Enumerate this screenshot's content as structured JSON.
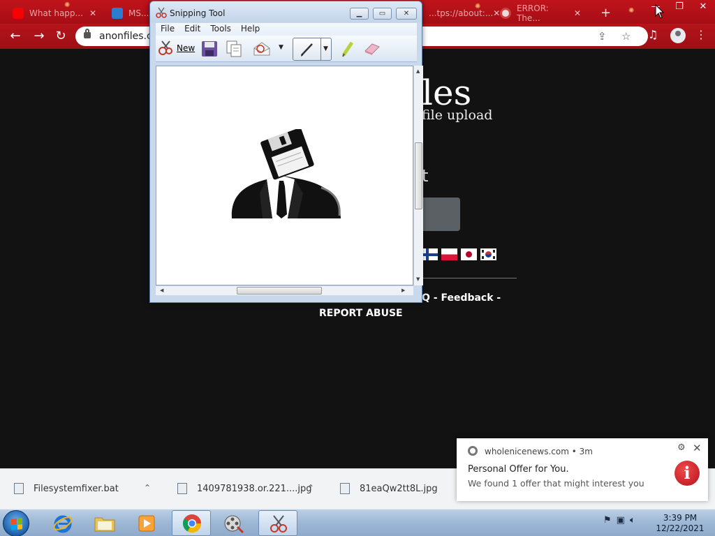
{
  "browser": {
    "tabs": [
      {
        "title": "What happ..."
      },
      {
        "title": "MS..."
      },
      {
        "title": "...tps://about:..."
      },
      {
        "title": "ERROR: The..."
      }
    ],
    "new_tab_label": "+",
    "url": "anonfiles.com",
    "window_controls": {
      "minimize": "—",
      "restore": "❐",
      "close": "✕"
    }
  },
  "page": {
    "logo_tail": "les",
    "tagline_tail": "file upload",
    "heading_tail": "t",
    "footer_tail": "Q - Feedback -",
    "report_abuse": "REPORT ABUSE"
  },
  "snipping_tool": {
    "title": "Snipping Tool",
    "menu": [
      "File",
      "Edit",
      "Tools",
      "Help"
    ],
    "new_label": "New"
  },
  "downloads": [
    {
      "name": "Filesystemfixer.bat"
    },
    {
      "name": "1409781938.or.221....jpg"
    },
    {
      "name": "81eaQw2tt8L.jpg"
    }
  ],
  "notification": {
    "source": "wholenicenews.com",
    "age": "3m",
    "title": "Personal Offer for You.",
    "body": "We found 1 offer that might interest you"
  },
  "taskbar": {
    "time": "3:39 PM",
    "date": "12/22/2021"
  },
  "colors": {
    "browser_accent": "#b5141b",
    "page_bg": "#121212",
    "notif_icon": "#c4161f"
  }
}
